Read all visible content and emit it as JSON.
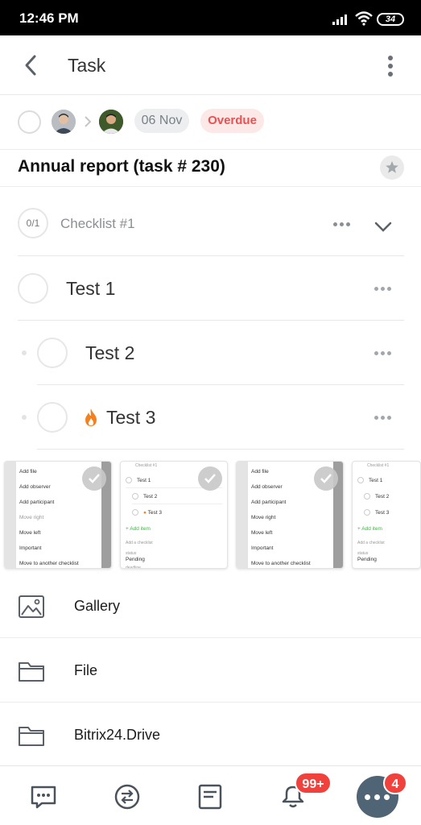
{
  "status_bar": {
    "time": "12:46 PM",
    "battery": "34"
  },
  "header": {
    "title": "Task"
  },
  "meta": {
    "date": "06 Nov",
    "status": "Overdue"
  },
  "task": {
    "title": "Annual report (task # 230)"
  },
  "checklist": {
    "progress": "0/1",
    "name": "Checklist #1",
    "items": [
      {
        "label": "Test 1"
      },
      {
        "label": "Test 2"
      },
      {
        "label": "Test 3",
        "important": true
      }
    ]
  },
  "thumbnails": {
    "menu_items": [
      "Add file",
      "Add observer",
      "Add participant",
      "Move right",
      "Move left",
      "Important",
      "Move to another checklist"
    ],
    "list": {
      "header": "Checklist #1",
      "items": [
        "Test 1",
        "Test 2",
        "Test 3"
      ],
      "add_item": "+ Add item",
      "add_checklist": "Add a checklist",
      "status_label": "status",
      "status_value": "Pending",
      "deadline_label": "deadline"
    }
  },
  "attachments": [
    {
      "label": "Gallery",
      "icon": "gallery-icon"
    },
    {
      "label": "File",
      "icon": "folder-icon"
    },
    {
      "label": "Bitrix24.Drive",
      "icon": "folder-icon"
    }
  ],
  "bottom_nav": {
    "notifications_badge": "99+",
    "more_badge": "4"
  },
  "colors": {
    "overdue": "#ea5151",
    "badge": "#f0413d",
    "more_button": "#4f6475",
    "fire": "#f4811f"
  }
}
